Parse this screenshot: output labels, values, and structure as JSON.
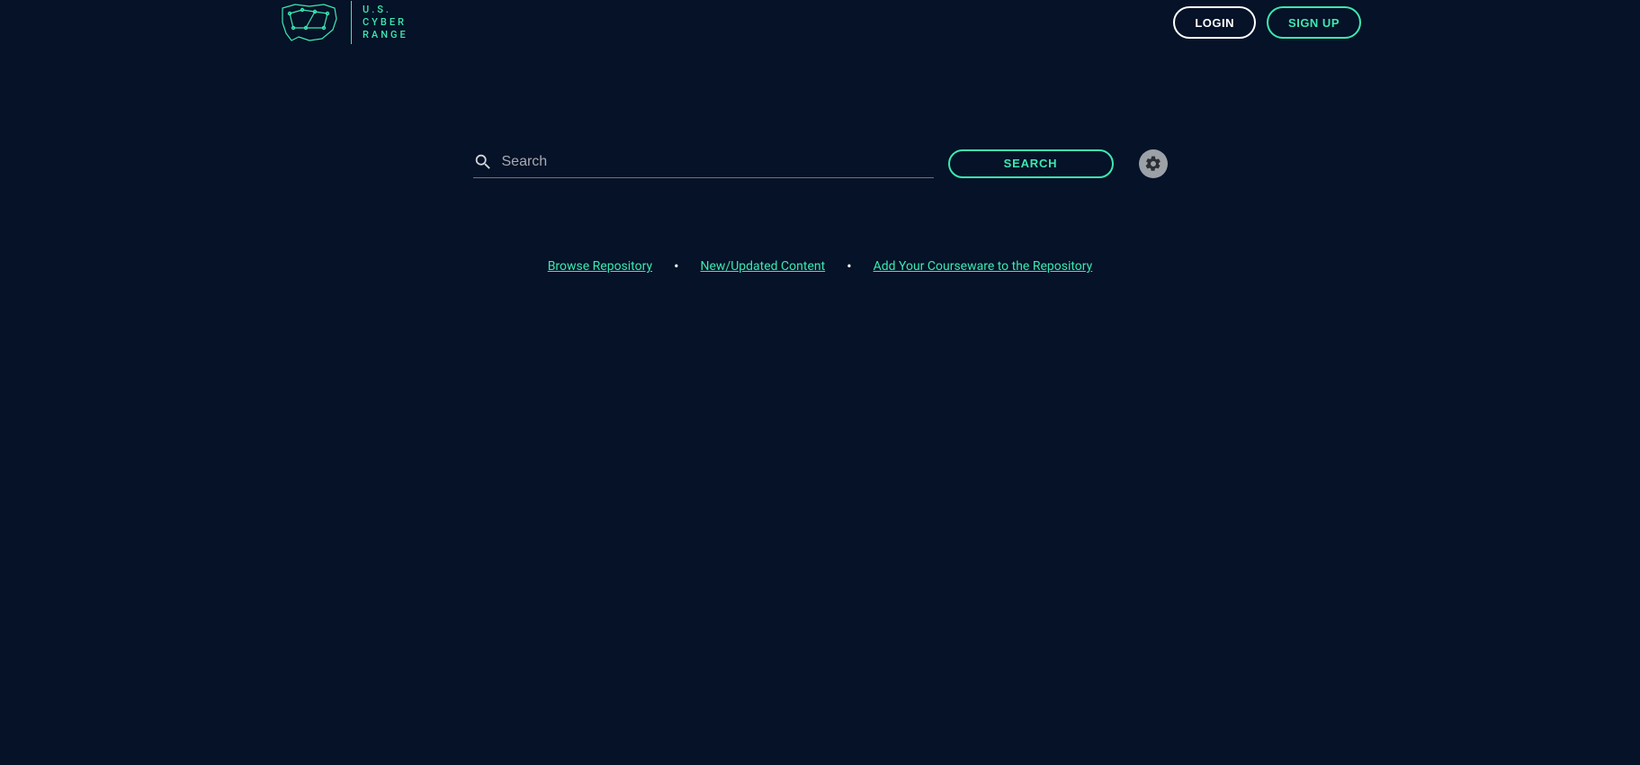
{
  "brand": {
    "line1": "U.S.",
    "line2": "CYBER",
    "line3": "RANGE"
  },
  "header": {
    "login_label": "LOGIN",
    "signup_label": "SIGN UP"
  },
  "search": {
    "placeholder": "Search",
    "button_label": "SEARCH",
    "value": ""
  },
  "links": {
    "browse": "Browse Repository",
    "new_updated": "New/Updated Content",
    "add_courseware": "Add Your Courseware to the Repository"
  },
  "colors": {
    "accent": "#3de8b0",
    "background": "#051227"
  }
}
